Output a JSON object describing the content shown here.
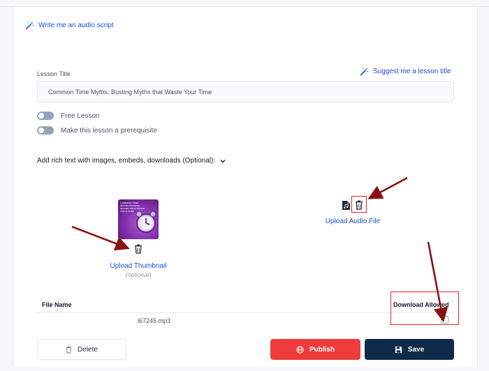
{
  "header": {
    "audio_script_link": "Write me an audio script"
  },
  "lesson": {
    "title_label": "Lesson Title",
    "suggest_title_link": "Suggest me a lesson title",
    "title_value": "Common Time Myths: Busting Myths that Waste Your Time"
  },
  "toggles": {
    "free_lesson": "Free Lesson",
    "prerequisite": "Make this lesson a prerequisite"
  },
  "rich_text": {
    "label": "Add rich text with images, embeds, downloads (Optional):"
  },
  "thumbnail": {
    "image_text": "COMMON TIME MYTHS BUSTING MYTHS THAT WASTE YOUR TIME",
    "upload_link": "Upload Thumbnail",
    "optional": "(optional)"
  },
  "audio": {
    "upload_link": "Upload Audio File"
  },
  "files_table": {
    "col_file_name": "File Name",
    "col_download_allowed": "Download Allowed",
    "rows": [
      {
        "file_name": "l67245.mp3",
        "download_allowed": false
      }
    ]
  },
  "actions": {
    "delete": "Delete",
    "publish": "Publish",
    "save": "Save"
  },
  "colors": {
    "link": "#1d4ed8",
    "publish": "#ef3b3b",
    "save": "#0f2a4a",
    "annotation": "#b91c1c"
  }
}
